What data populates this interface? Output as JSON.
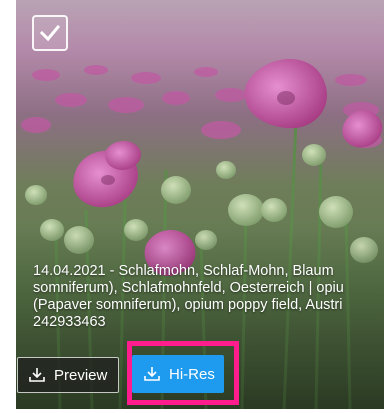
{
  "caption": {
    "lines": [
      "14.04.2021 - Schlafmohn, Schlaf-Mohn, Blaum",
      "somniferum), Schlafmohnfeld, Oesterreich | opiu",
      "(Papaver somniferum), opium poppy field, Austri",
      "242933463"
    ]
  },
  "buttons": {
    "preview_label": "Preview",
    "hires_label": "Hi-Res"
  },
  "icons": {
    "select": "checkmark-icon",
    "preview": "download-icon",
    "hires": "download-icon"
  },
  "colors": {
    "hires_button": "#1e9bef",
    "highlight": "#ff1d8e"
  }
}
